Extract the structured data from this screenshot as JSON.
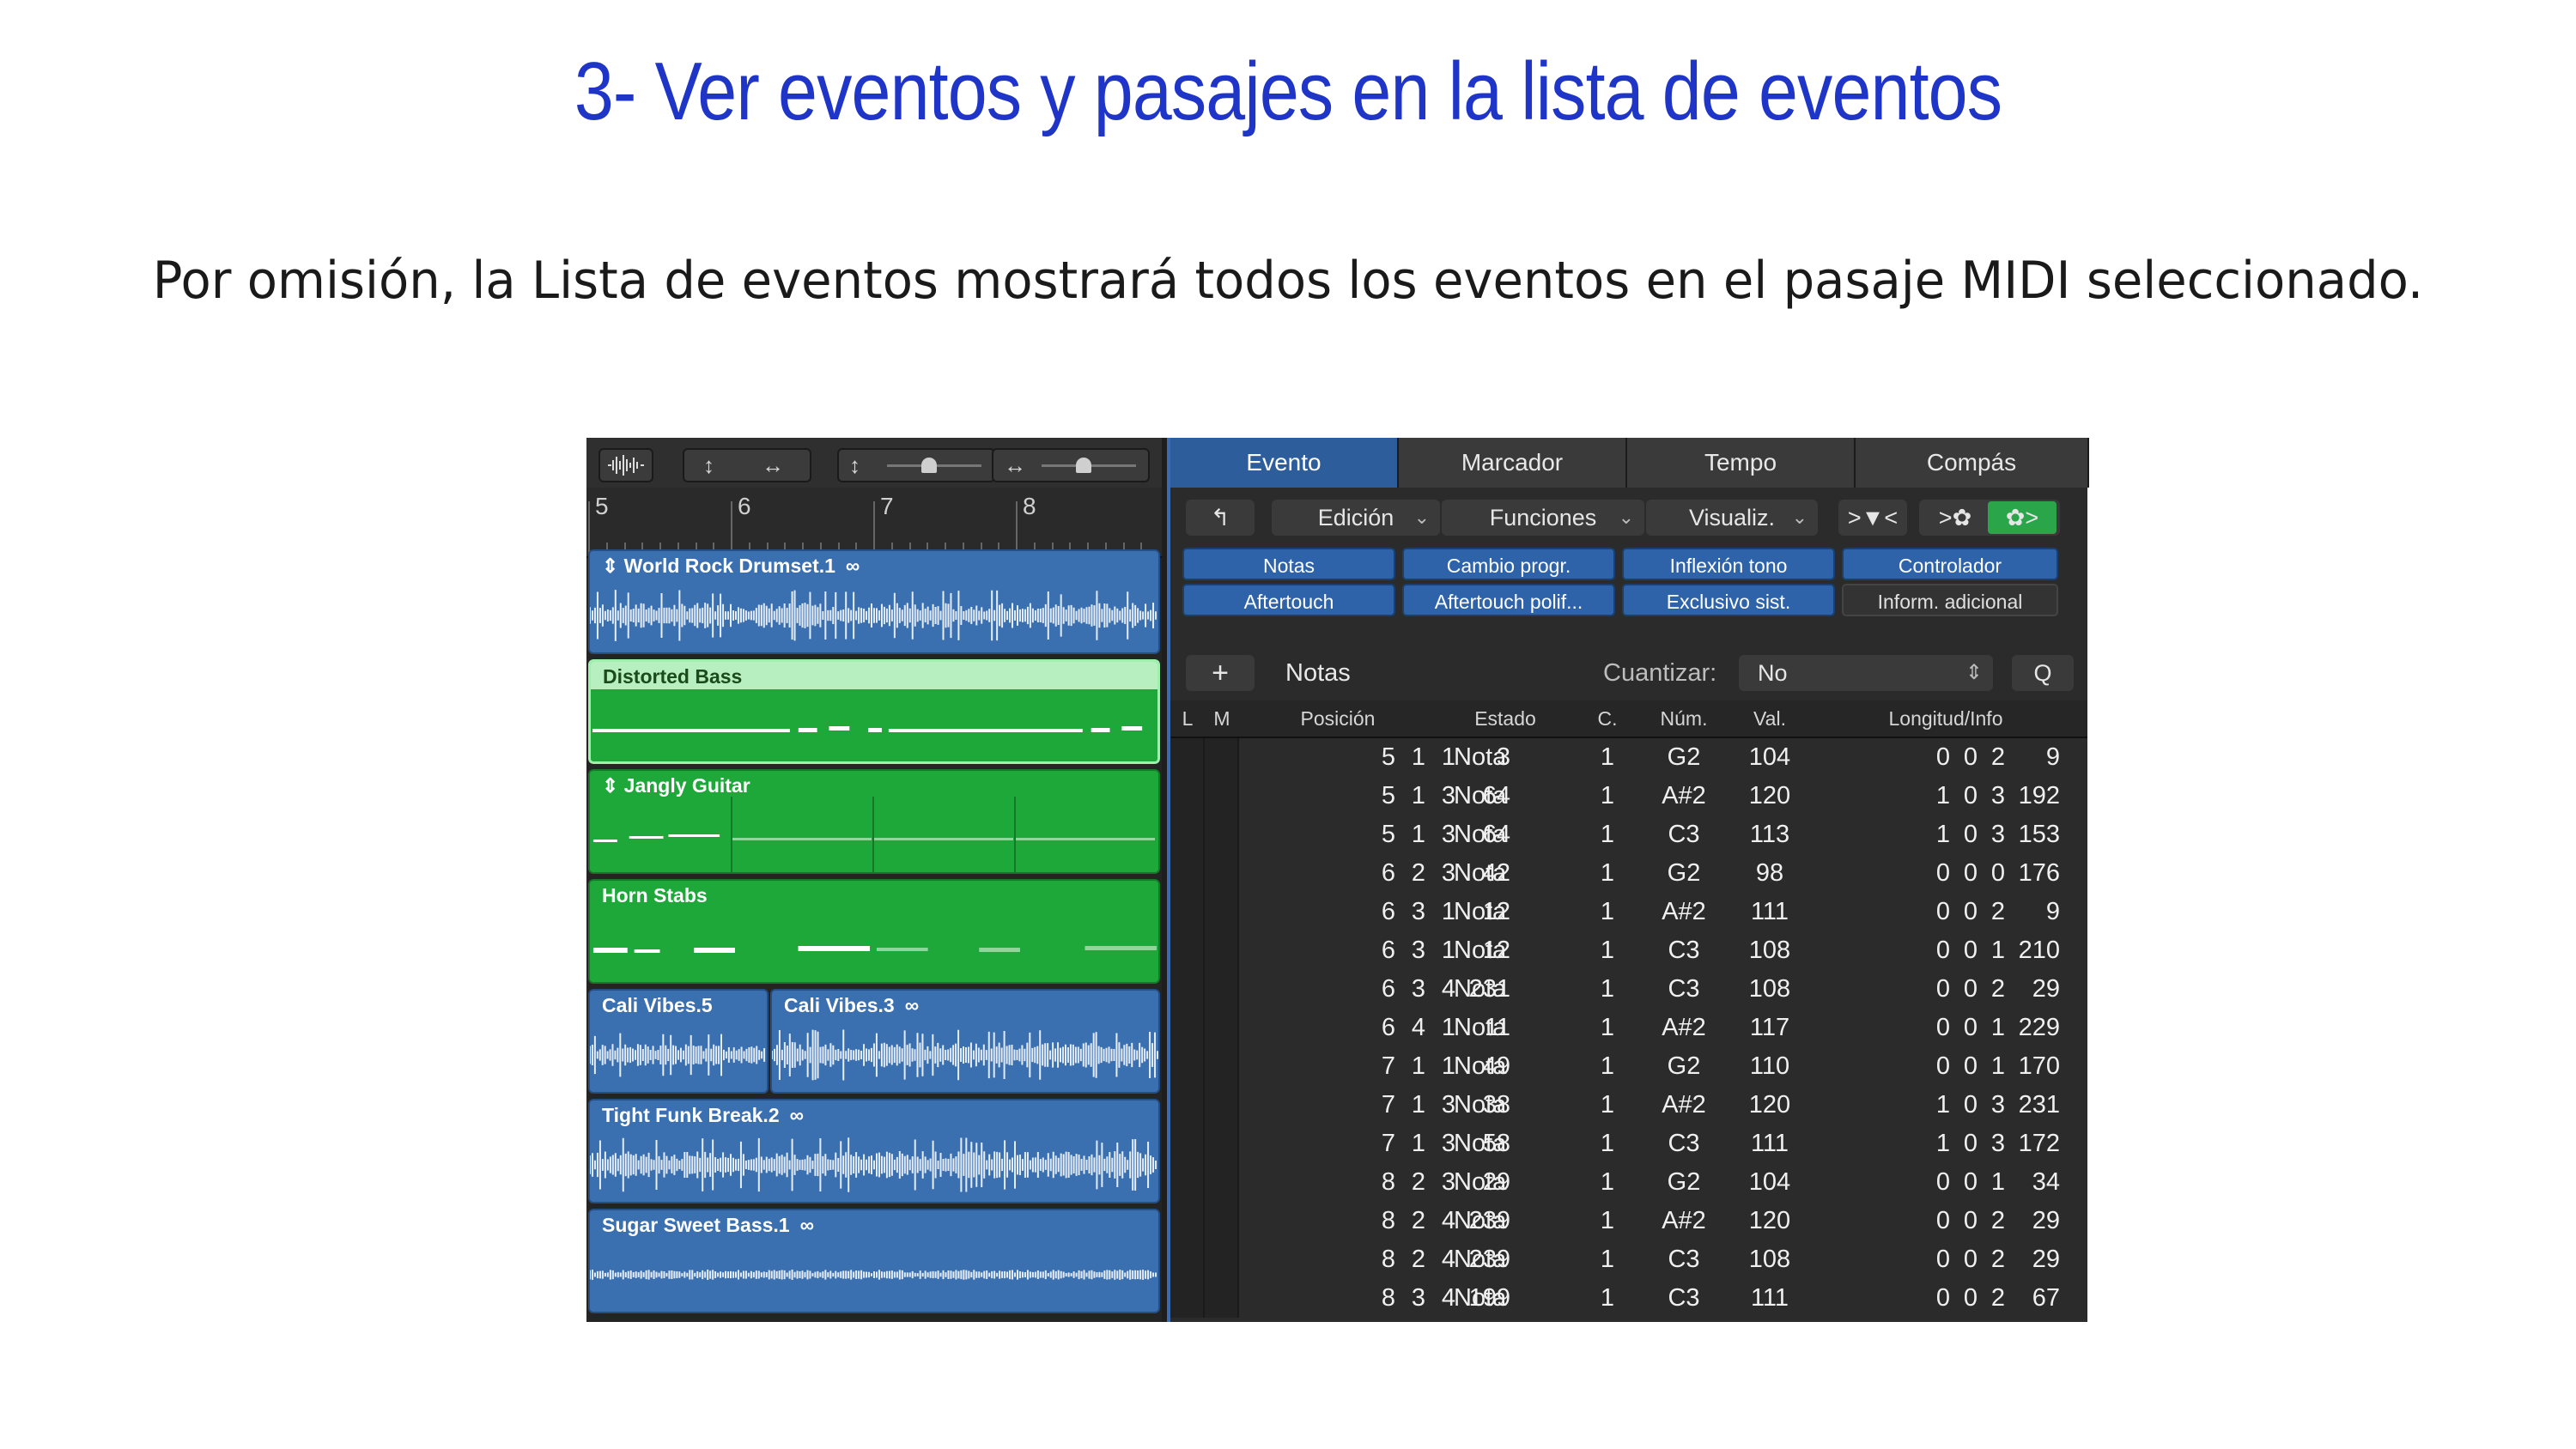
{
  "slide": {
    "title": "3- Ver eventos y pasajes en la lista de eventos",
    "subtitle": "Por omisión, la Lista de eventos mostrará todos los eventos en el pasaje MIDI seleccionado."
  },
  "tracks_area": {
    "ruler_bars": [
      "5",
      "6",
      "7",
      "8"
    ],
    "regions": [
      {
        "name": "World Rock Drumset.1",
        "kind": "audio",
        "color": "#3a6fb0"
      },
      {
        "name": "Distorted Bass",
        "kind": "midi-selected",
        "color": "#b8efc0"
      },
      {
        "name": "Jangly Guitar",
        "kind": "midi",
        "color": "#1fa83a"
      },
      {
        "name": "Horn Stabs",
        "kind": "midi",
        "color": "#1fa83a"
      },
      {
        "name": "Cali Vibes.5",
        "kind": "audio",
        "color": "#3a6fb0"
      },
      {
        "name": "Cali Vibes.3",
        "kind": "audio",
        "color": "#3a6fb0"
      },
      {
        "name": "Tight Funk Break.2",
        "kind": "audio",
        "color": "#3a6fb0"
      },
      {
        "name": "Sugar Sweet Bass.1",
        "kind": "audio",
        "color": "#3a6fb0"
      }
    ]
  },
  "event_list": {
    "tabs": [
      "Evento",
      "Marcador",
      "Tempo",
      "Compás"
    ],
    "menus": [
      "Edición",
      "Funciones",
      "Visualiz."
    ],
    "filters": [
      "Notas",
      "Cambio progr.",
      "Inflexión tono",
      "Controlador",
      "Aftertouch",
      "Aftertouch polif...",
      "Exclusivo sist.",
      "Inform. adicional"
    ],
    "create_label": "Notas",
    "quantize_label": "Cuantizar:",
    "quantize_value": "No",
    "q_button": "Q",
    "columns": [
      "L",
      "M",
      "Posición",
      "Estado",
      "C.",
      "Núm.",
      "Val.",
      "Longitud/Info"
    ],
    "rows": [
      {
        "pos": [
          "5",
          "1",
          "1",
          "3"
        ],
        "status": "Nota",
        "ch": "1",
        "num": "G2",
        "val": "104",
        "len": [
          "0",
          "0",
          "2",
          "9"
        ]
      },
      {
        "pos": [
          "5",
          "1",
          "3",
          "64"
        ],
        "status": "Nota",
        "ch": "1",
        "num": "A#2",
        "val": "120",
        "len": [
          "1",
          "0",
          "3",
          "192"
        ]
      },
      {
        "pos": [
          "5",
          "1",
          "3",
          "64"
        ],
        "status": "Nota",
        "ch": "1",
        "num": "C3",
        "val": "113",
        "len": [
          "1",
          "0",
          "3",
          "153"
        ]
      },
      {
        "pos": [
          "6",
          "2",
          "3",
          "42"
        ],
        "status": "Nota",
        "ch": "1",
        "num": "G2",
        "val": "98",
        "len": [
          "0",
          "0",
          "0",
          "176"
        ]
      },
      {
        "pos": [
          "6",
          "3",
          "1",
          "12"
        ],
        "status": "Nota",
        "ch": "1",
        "num": "A#2",
        "val": "111",
        "len": [
          "0",
          "0",
          "2",
          "9"
        ]
      },
      {
        "pos": [
          "6",
          "3",
          "1",
          "12"
        ],
        "status": "Nota",
        "ch": "1",
        "num": "C3",
        "val": "108",
        "len": [
          "0",
          "0",
          "1",
          "210"
        ]
      },
      {
        "pos": [
          "6",
          "3",
          "4",
          "231"
        ],
        "status": "Nota",
        "ch": "1",
        "num": "C3",
        "val": "108",
        "len": [
          "0",
          "0",
          "2",
          "29"
        ]
      },
      {
        "pos": [
          "6",
          "4",
          "1",
          "11"
        ],
        "status": "Nota",
        "ch": "1",
        "num": "A#2",
        "val": "117",
        "len": [
          "0",
          "0",
          "1",
          "229"
        ]
      },
      {
        "pos": [
          "7",
          "1",
          "1",
          "49"
        ],
        "status": "Nota",
        "ch": "1",
        "num": "G2",
        "val": "110",
        "len": [
          "0",
          "0",
          "1",
          "170"
        ]
      },
      {
        "pos": [
          "7",
          "1",
          "3",
          "38"
        ],
        "status": "Nota",
        "ch": "1",
        "num": "A#2",
        "val": "120",
        "len": [
          "1",
          "0",
          "3",
          "231"
        ]
      },
      {
        "pos": [
          "7",
          "1",
          "3",
          "58"
        ],
        "status": "Nota",
        "ch": "1",
        "num": "C3",
        "val": "111",
        "len": [
          "1",
          "0",
          "3",
          "172"
        ]
      },
      {
        "pos": [
          "8",
          "2",
          "3",
          "29"
        ],
        "status": "Nota",
        "ch": "1",
        "num": "G2",
        "val": "104",
        "len": [
          "0",
          "0",
          "1",
          "34"
        ]
      },
      {
        "pos": [
          "8",
          "2",
          "4",
          "239"
        ],
        "status": "Nota",
        "ch": "1",
        "num": "A#2",
        "val": "120",
        "len": [
          "0",
          "0",
          "2",
          "29"
        ]
      },
      {
        "pos": [
          "8",
          "2",
          "4",
          "239"
        ],
        "status": "Nota",
        "ch": "1",
        "num": "C3",
        "val": "108",
        "len": [
          "0",
          "0",
          "2",
          "29"
        ]
      },
      {
        "pos": [
          "8",
          "3",
          "4",
          "199"
        ],
        "status": "Nota",
        "ch": "1",
        "num": "C3",
        "val": "111",
        "len": [
          "0",
          "0",
          "2",
          "67"
        ]
      }
    ]
  }
}
